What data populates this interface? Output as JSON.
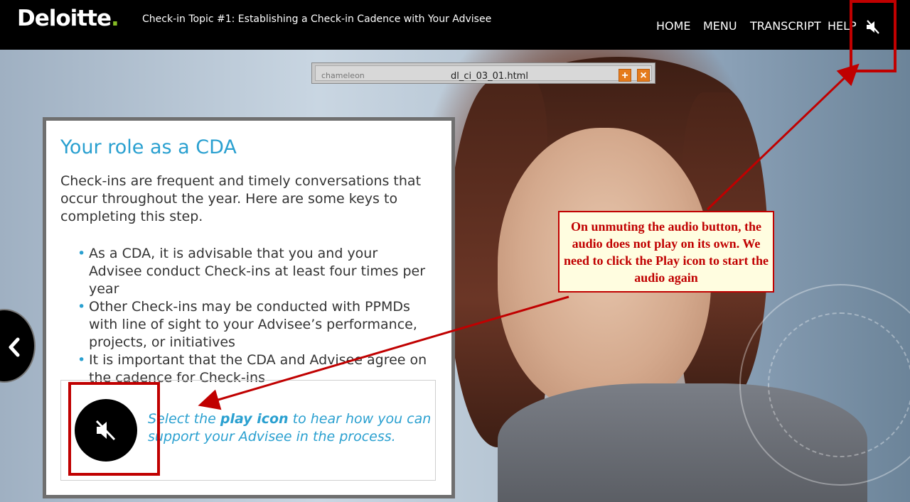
{
  "header": {
    "logo_text": "Deloitte",
    "logo_dot": ".",
    "course_title": "Check-in Topic #1: Establishing a Check-in Cadence with Your Advisee",
    "nav": {
      "home": "HOME",
      "menu": "MENU",
      "transcript": "TRANSCRIPT",
      "help": "HELP"
    },
    "mute_icon": "speaker-muted-icon"
  },
  "popup": {
    "logo": "chameleon",
    "file_name": "dl_ci_03_01.html",
    "add_symbol": "+",
    "close_symbol": "×"
  },
  "card": {
    "title": "Your role as a CDA",
    "intro": "Check-ins are frequent and timely conversations that occur throughout the year. Here are some keys to completing this step.",
    "bullet_mark": "•",
    "bullets": [
      "As a CDA, it is advisable that you and your Advisee conduct Check-ins at least four times per year",
      "Other Check-ins may be conducted with PPMDs with line of sight to your Advisee’s performance, projects, or initiatives",
      "It is important that the CDA and Advisee agree on the cadence for Check-ins"
    ],
    "audio": {
      "prefix": "Select the ",
      "bold": "play icon",
      "suffix": " to hear how you can support your Advisee in the process.",
      "icon": "speaker-muted-icon"
    }
  },
  "annotation": {
    "callout_text": "On unmuting the audio button, the audio does not play on its own. We need to click the Play icon to start the audio again",
    "color": "#c00000"
  },
  "colors": {
    "accent_blue": "#2aa0d0",
    "deloitte_green": "#86bc25",
    "header_bg": "#000000"
  }
}
